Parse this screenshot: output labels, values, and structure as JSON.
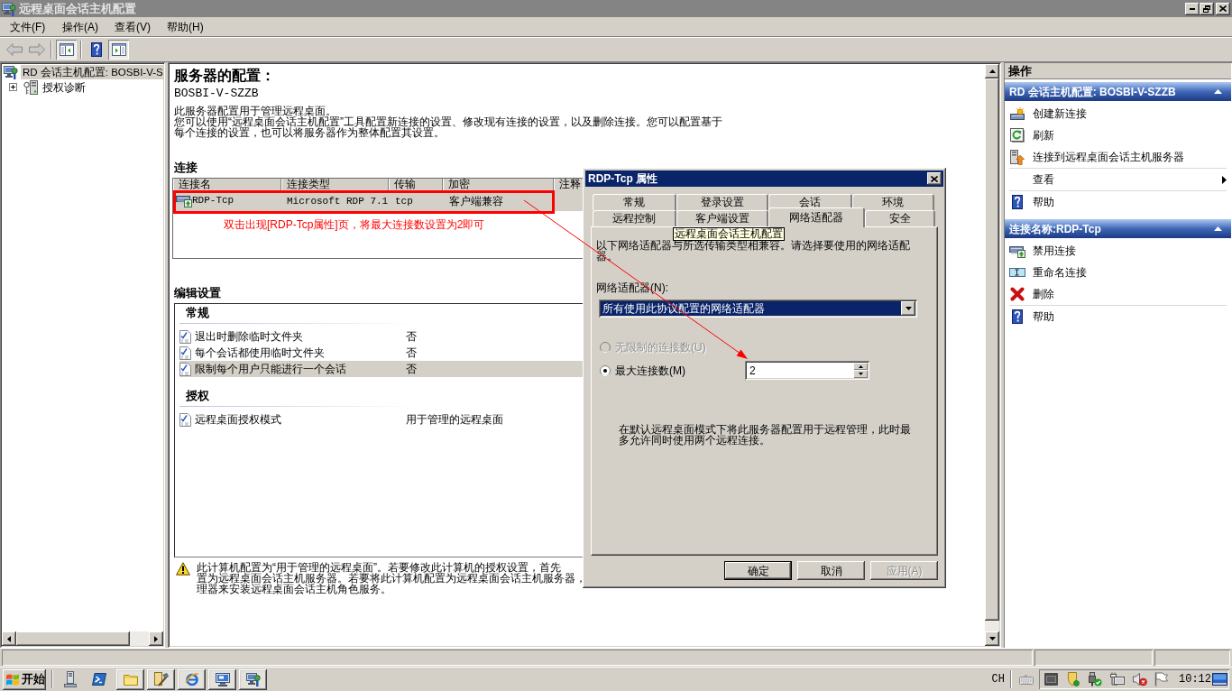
{
  "window": {
    "title": "远程桌面会话主机配置",
    "active": false
  },
  "menu": [
    "文件(F)",
    "操作(A)",
    "查看(V)",
    "帮助(H)"
  ],
  "toolbar": [
    [
      {
        "kind": "back",
        "disabled": true,
        "pressed": false
      },
      {
        "kind": "forward",
        "disabled": true,
        "pressed": false
      }
    ],
    [
      {
        "kind": "tree_toggle",
        "disabled": false,
        "pressed": true
      }
    ],
    [
      {
        "kind": "help",
        "disabled": false,
        "pressed": false
      },
      {
        "kind": "pane_toggle",
        "disabled": false,
        "pressed": true
      }
    ]
  ],
  "tree": [
    {
      "label": "RD 会话主机配置: BOSBI-V-S",
      "kind": "config",
      "selected": true,
      "children": [
        {
          "label": "授权诊断",
          "kind": "diagnostics",
          "selected": false,
          "expanded": false
        }
      ]
    }
  ],
  "details": {
    "title": "服务器的配置：",
    "server": "BOSBI-V-SZZB",
    "summary": "此服务器配置用于管理远程桌面。",
    "description_lines": [
      "您可以使用“远程桌面会话主机配置”工具配置新连接的设置、修改现有连接的设置，以及删除连接。您可以配置基于",
      "每个连接的设置，也可以将服务器作为整体配置其设置。"
    ]
  },
  "connections": {
    "heading": "连接",
    "columns": [
      "连接名",
      "连接类型",
      "传输",
      "加密",
      "注释"
    ],
    "rows": [
      {
        "name": "RDP-Tcp",
        "type": "Microsoft RDP 7.1",
        "transport": "tcp",
        "encryption": "客户端兼容",
        "selected": true
      }
    ]
  },
  "annotation": {
    "text": "双击出现[RDP-Tcp属性]页，将最大连接数设置为2即可"
  },
  "settings": {
    "heading": "编辑设置",
    "groups": [
      {
        "title": "常规",
        "items": [
          {
            "label": "退出时删除临时文件夹",
            "value": "否",
            "selected": false
          },
          {
            "label": "每个会话都使用临时文件夹",
            "value": "否",
            "selected": false
          },
          {
            "label": "限制每个用户只能进行一个会话",
            "value": "否",
            "selected": true
          }
        ]
      },
      {
        "title": "授权",
        "items": [
          {
            "label": "远程桌面授权模式",
            "value": "用于管理的远程桌面",
            "selected": false
          }
        ]
      }
    ]
  },
  "warning": {
    "lines": [
      "此计算机配置为“用于管理的远程桌面”。若要修改此计算机的授权设置，首先",
      "置为远程桌面会话主机服务器。若要将此计算机配置为远程桌面会话主机服务器，",
      "理器来安装远程桌面会话主机角色服务。"
    ]
  },
  "actions": {
    "title": "操作",
    "sections": [
      {
        "title": "RD 会话主机配置: BOSBI-V-SZZB",
        "expanded": true,
        "groups": [
          [
            {
              "kind": "create",
              "label": "创建新连接"
            },
            {
              "kind": "refresh",
              "label": "刷新"
            },
            {
              "kind": "connect",
              "label": "连接到远程桌面会话主机服务器"
            }
          ],
          [
            {
              "kind": "submenu",
              "label": "查看"
            }
          ],
          [
            {
              "kind": "help",
              "label": "帮助"
            }
          ]
        ]
      },
      {
        "title": "连接名称:RDP-Tcp",
        "expanded": true,
        "groups": [
          [
            {
              "kind": "disable",
              "label": "禁用连接"
            },
            {
              "kind": "rename",
              "label": "重命名连接"
            },
            {
              "kind": "delete",
              "label": "删除"
            }
          ],
          [
            {
              "kind": "help",
              "label": "帮助"
            }
          ]
        ]
      }
    ]
  },
  "dialog": {
    "title": "RDP-Tcp 属性",
    "active": true,
    "tab_rows": [
      [
        {
          "label": "常规",
          "selected": false
        },
        {
          "label": "登录设置",
          "selected": false
        },
        {
          "label": "会话",
          "selected": false
        },
        {
          "label": "环境",
          "selected": false
        }
      ],
      [
        {
          "label": "远程控制",
          "selected": false
        },
        {
          "label": "客户端设置",
          "selected": false
        },
        {
          "label": "网络适配器",
          "selected": true
        },
        {
          "label": "安全",
          "selected": false
        }
      ]
    ],
    "tooltip": "远程桌面会话主机配置",
    "description_lines": [
      "以下网络适配器与所选传输类型相兼容。请选择要使用的网络适配",
      "器。"
    ],
    "adapter_label": "网络适配器(N):",
    "adapter_value": "所有使用此协议配置的网络适配器",
    "options": [
      {
        "label": "无限制的连接数(U)",
        "selected": false,
        "disabled": true
      },
      {
        "label": "最大连接数(M)",
        "selected": true,
        "disabled": false,
        "value": "2"
      }
    ],
    "note_lines": [
      "在默认远程桌面模式下将此服务器配置用于远程管理，此时最",
      "多允许同时使用两个远程连接。"
    ],
    "buttons": [
      {
        "label": "确定",
        "default": true,
        "disabled": false
      },
      {
        "label": "取消",
        "default": false,
        "disabled": false
      },
      {
        "label": "应用(A)",
        "default": false,
        "disabled": true
      }
    ]
  },
  "taskbar": {
    "start": "开始",
    "language": "CH",
    "clock": "10:12"
  }
}
